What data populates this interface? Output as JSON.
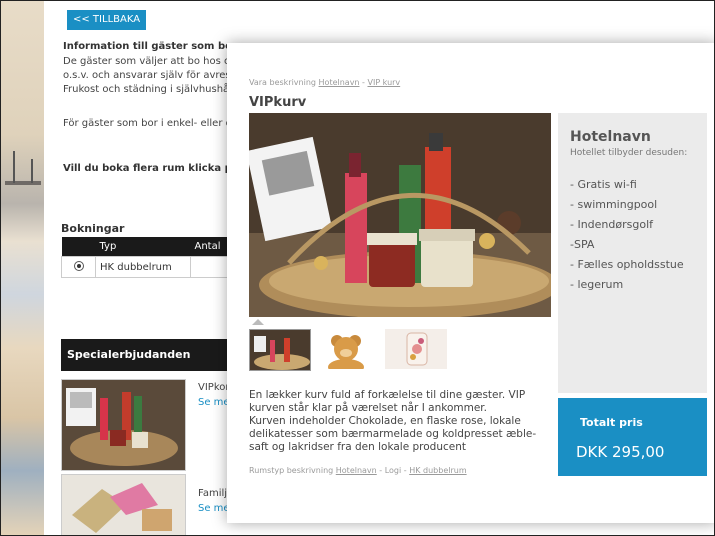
{
  "background": {
    "back_button": "<< TILLBAKA",
    "info_heading": "Information till gäster som bor",
    "info_lines": [
      "De gäster som väljer att bo hos os",
      "o.s.v. och ansvarar själv för avrese",
      "Frukost och städning i självhushåll",
      "För gäster som bor i enkel- eller d"
    ],
    "multi_rooms": "Vill du boka flera rum klicka på",
    "bookings_heading": "Bokningar",
    "table": {
      "col_type": "Typ",
      "col_count": "Antal",
      "row_type": "HK dubbelrum"
    },
    "special_heading": "Specialerbjudanden",
    "offers": [
      {
        "title": "VIPkor",
        "link": "Se me"
      },
      {
        "title": "Familj",
        "link": "Se me"
      }
    ]
  },
  "modal": {
    "breadcrumb": {
      "prefix": "Vara beskrivning",
      "link1": "Hotelnavn",
      "sep": "-",
      "link2": "VIP kurv"
    },
    "title": "VIPkurv",
    "description": [
      "En lækker kurv fuld af forkælelse til dine gæster. VIP kurven står klar på værelset når I ankommer.",
      "Kurven indeholder Chokolade, en flaske rose, lokale delikatesser som bærmarmelade og koldpresset æble-saft og lakridser fra den lokale producent"
    ],
    "room_type": {
      "prefix": "Rumstyp beskrivning",
      "link1": "Hotelnavn",
      "mid": "- Logi -",
      "link2": "HK dubbelrum"
    },
    "side": {
      "hotel_name": "Hotelnavn",
      "subtitle": "Hotellet tilbyder desuden:",
      "amenities": [
        "- Gratis wi-fi",
        "- swimmingpool",
        "- Indendørsgolf",
        "-SPA",
        "- Fælles opholdsstue",
        "- legerum"
      ]
    },
    "price": {
      "label": "Totalt pris",
      "value": "DKK 295,00"
    }
  },
  "colors": {
    "accent": "#1a8fc4",
    "dark_bar": "#1a1a1a",
    "side_panel": "#ebebeb"
  }
}
